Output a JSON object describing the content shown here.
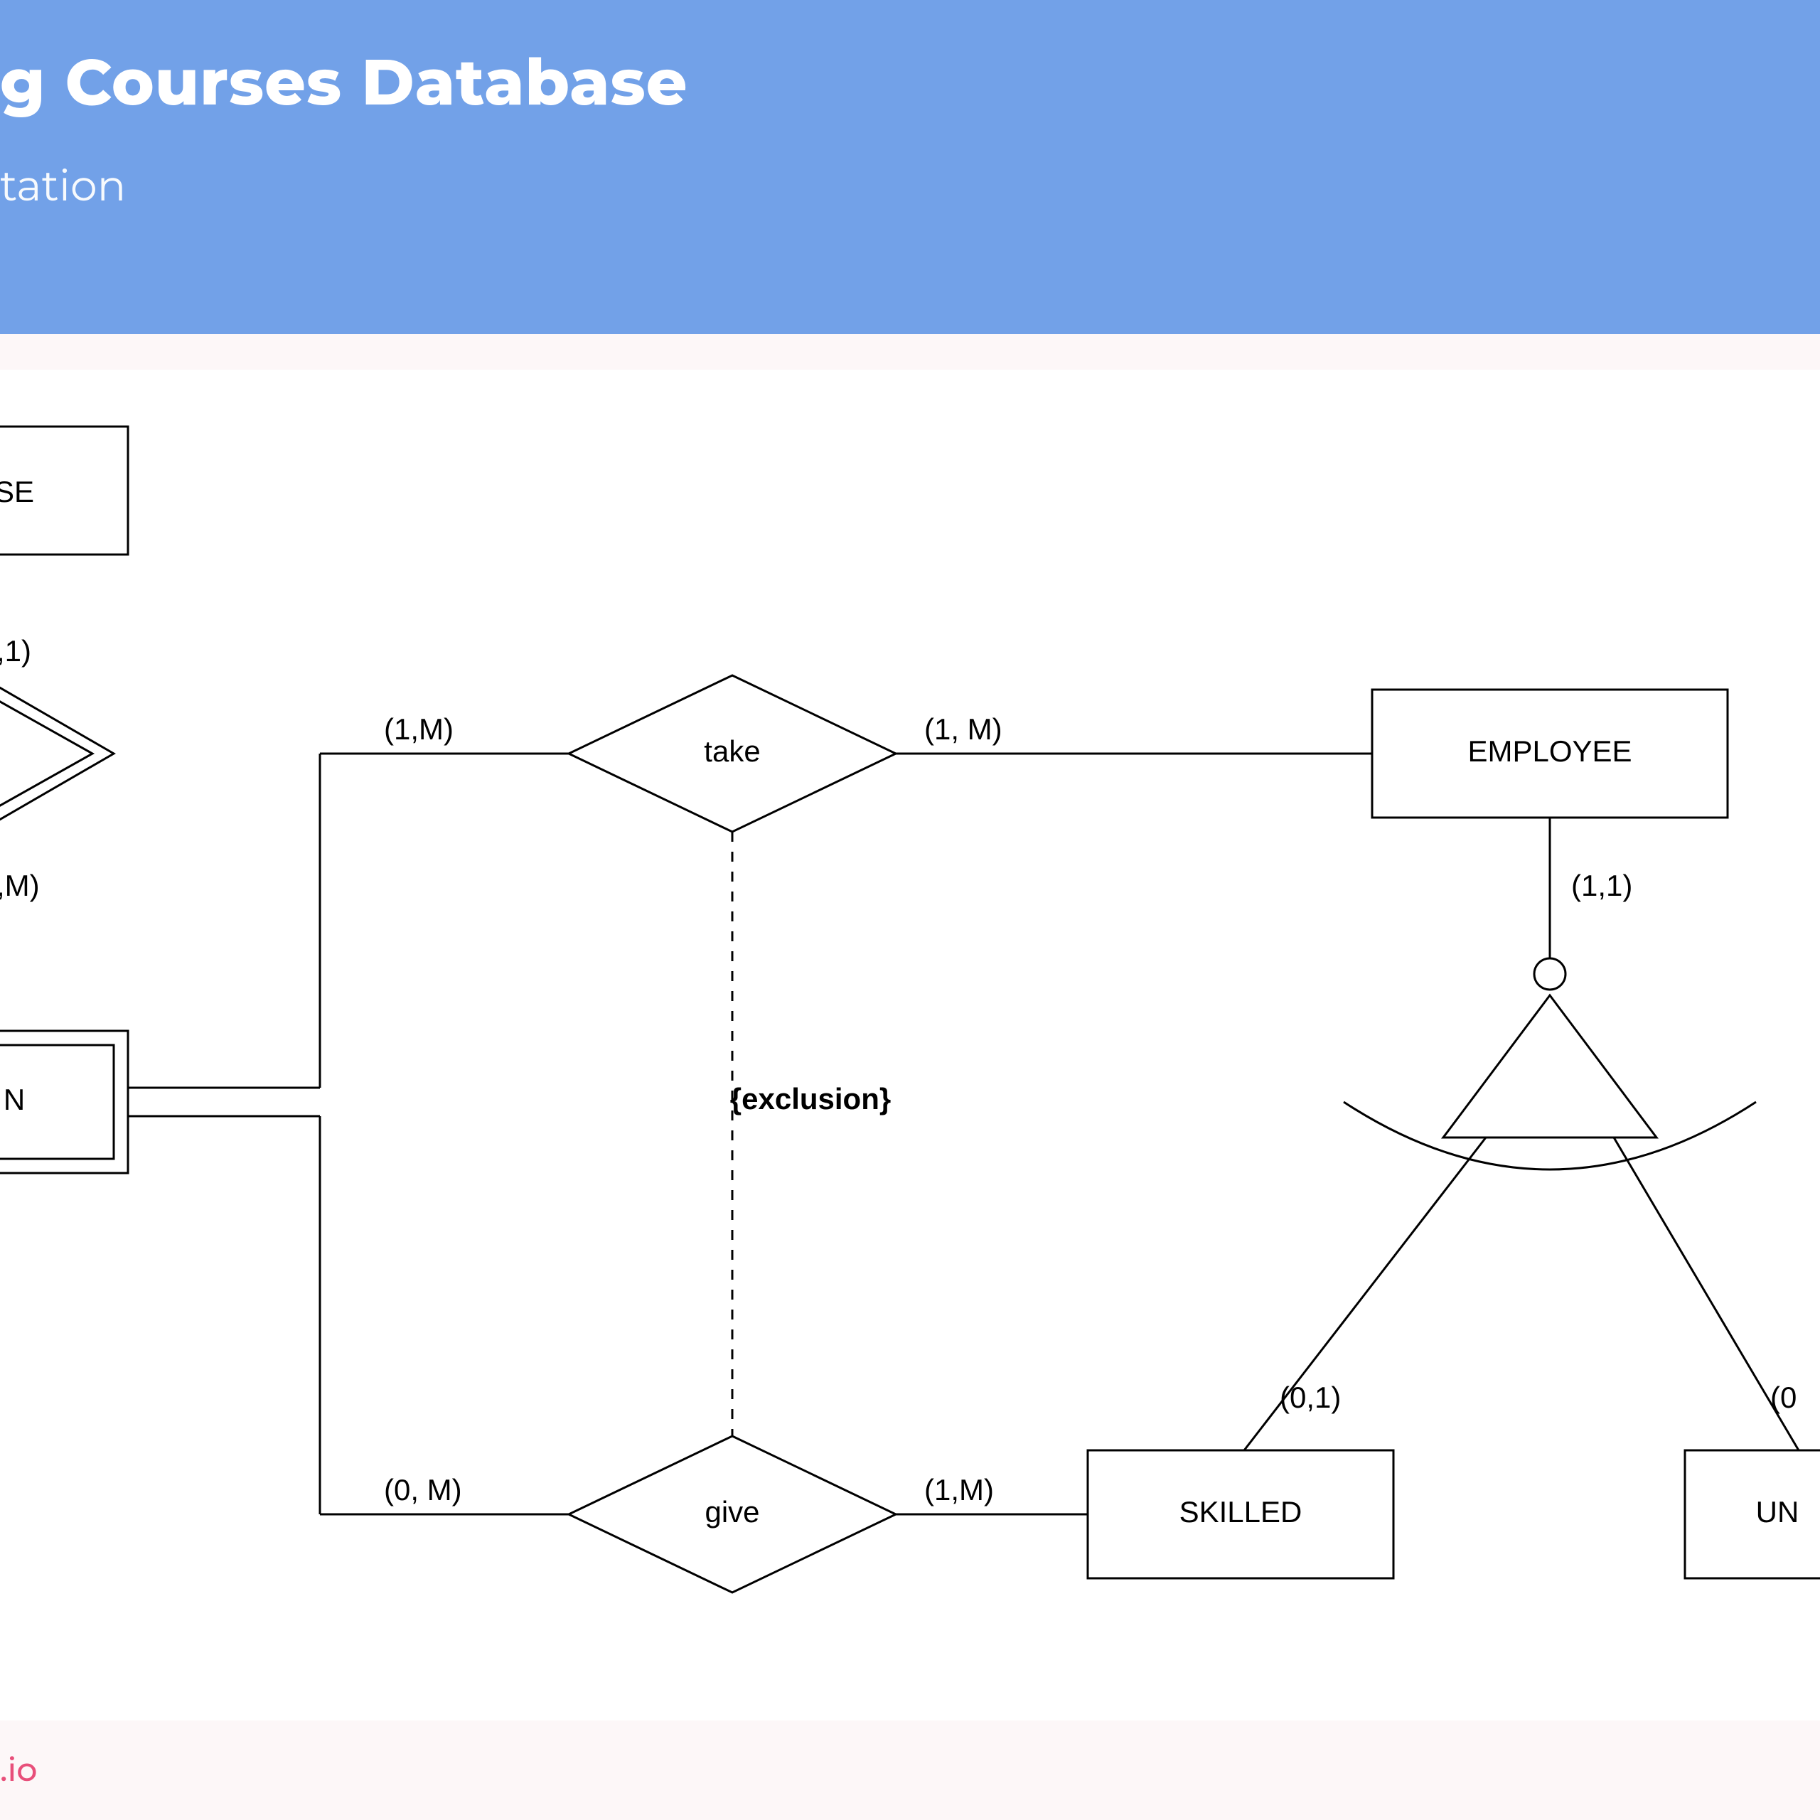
{
  "header": {
    "title_partial": "g Courses Database",
    "subtitle_partial": "tation"
  },
  "entities": {
    "course_partial": "SE",
    "employee": "EMPLOYEE",
    "skilled": "SKILLED",
    "unskilled_partial": "UN",
    "weak_partial": "N"
  },
  "relationships": {
    "take": "take",
    "give": "give"
  },
  "constraint": "{exclusion}",
  "cardinalities": {
    "top_left_partial_1": ",1)",
    "top_left_partial_2": ",M)",
    "take_left": "(1,M)",
    "take_right": "(1, M)",
    "give_left": "(0, M)",
    "give_right": "(1,M)",
    "employee_down": "(1,1)",
    "skilled_up": "(0,1)",
    "unskilled_up_partial": "(0"
  },
  "footer": ".io"
}
